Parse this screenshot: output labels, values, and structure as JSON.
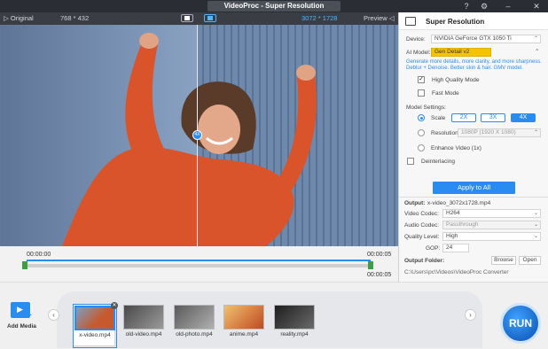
{
  "titlebar": {
    "title": "VideoProc  -  Super Resolution"
  },
  "preview": {
    "original_label": "Original",
    "left_dims": "768 * 432",
    "right_dims": "3072 * 1728",
    "preview_label": "Preview",
    "handle_label": "4X"
  },
  "timeline": {
    "start": "00:00:00",
    "end_top": "00:00:05",
    "end_bottom": "00:00:05"
  },
  "panel": {
    "title": "Super Resolution",
    "device_label": "Device:",
    "device_value": "NVIDIA GeForce GTX 1050 Ti",
    "model_label": "AI Model:",
    "model_value": "Gen Detail v2",
    "model_note": "Generate more details, more clarity, and more sharpness. Deblur + Denoise. Better skin & hair. GMV model.",
    "hq_label": "High Quality Mode",
    "fast_label": "Fast Mode",
    "settings_label": "Model Settings:",
    "scale_label": "Scale",
    "scale_opts": [
      "2X",
      "3X",
      "4X"
    ],
    "resolution_label": "Resolution",
    "resolution_value": "1080P (1920 X 1080)",
    "enhance_label": "Enhance Video (1x)",
    "deinterlace_label": "Deinterlacing",
    "apply_label": "Apply to All",
    "output_label": "Output:",
    "output_file": "x-video_3072x1728.mp4",
    "vcodec_label": "Video Codec:",
    "vcodec_value": "H264",
    "acodec_label": "Audio Codec:",
    "acodec_value": "Passthrough",
    "quality_label": "Quality Level:",
    "quality_value": "High",
    "gop_label": "GOP:",
    "gop_value": "24",
    "folder_label": "Output Folder:",
    "browse_label": "Browse",
    "open_label": "Open",
    "folder_path": "C:\\Users\\pc\\Videos\\VideoProc Converter"
  },
  "media": {
    "add_label": "Add Media",
    "items": [
      {
        "name": "x-video.mp4",
        "color": "#c65a2e"
      },
      {
        "name": "old-video.mp4",
        "color": "#7a7a7a"
      },
      {
        "name": "old-photo.mp4",
        "color": "#8f8f8f"
      },
      {
        "name": "anime.mp4",
        "color": "#d8902e"
      },
      {
        "name": "reality.mp4",
        "color": "#3a3a3a"
      }
    ],
    "run_label": "RUN"
  }
}
